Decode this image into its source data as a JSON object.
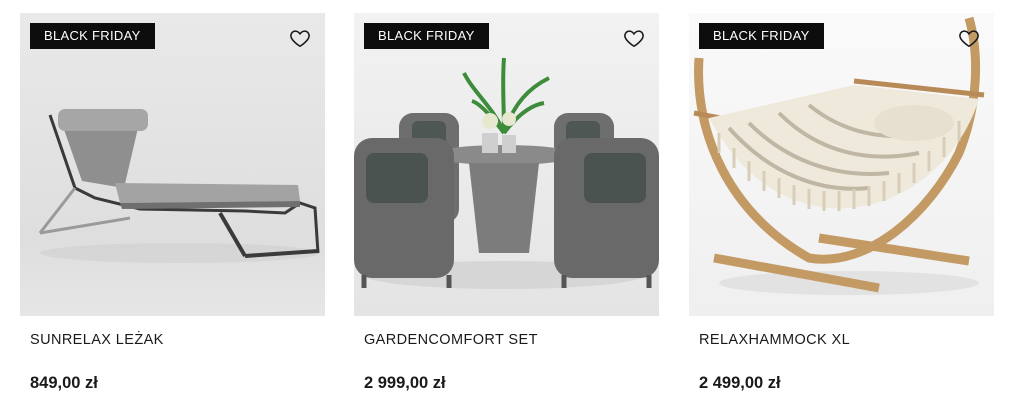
{
  "products": [
    {
      "badge": "BLACK FRIDAY",
      "name": "SUNRELAX LEŻAK",
      "price": "849,00 zł",
      "image": "sun-lounger-image",
      "favorite_icon": "heart-outline-icon"
    },
    {
      "badge": "BLACK FRIDAY",
      "name": "GARDENCOMFORT SET",
      "price": "2 999,00 zł",
      "image": "wicker-garden-set-image",
      "favorite_icon": "heart-outline-icon"
    },
    {
      "badge": "BLACK FRIDAY",
      "name": "RELAXHAMMOCK XL",
      "price": "2 499,00 zł",
      "image": "hammock-stand-image",
      "favorite_icon": "heart-outline-icon"
    }
  ],
  "colors": {
    "badge_bg": "#0d0d0d",
    "badge_text": "#ffffff",
    "text": "#1a1a1a"
  }
}
